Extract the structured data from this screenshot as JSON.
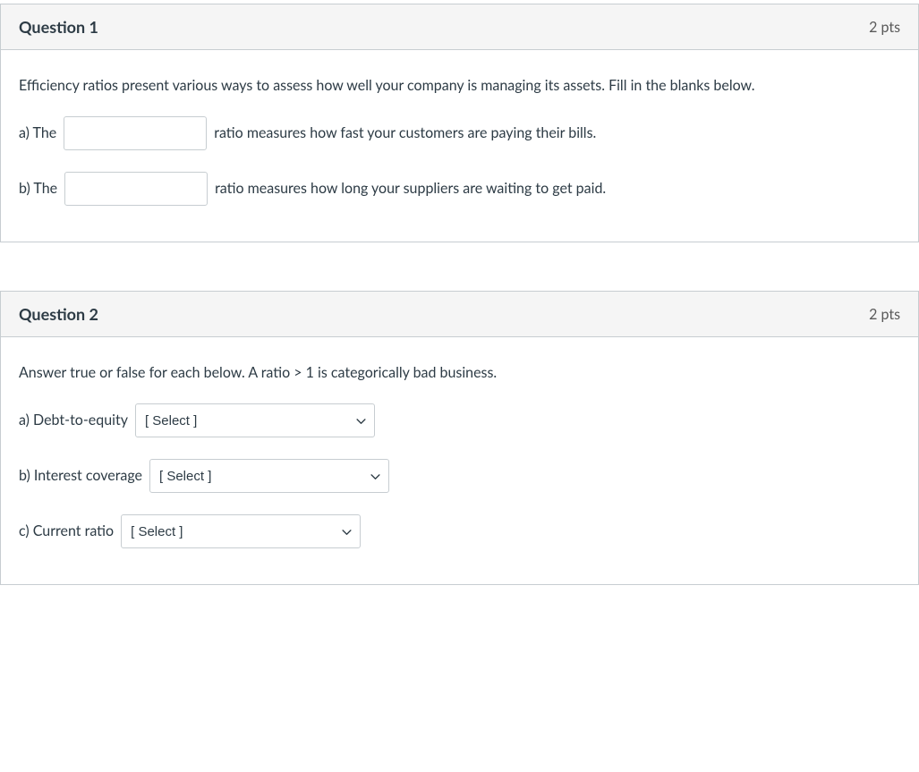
{
  "questions": [
    {
      "title": "Question 1",
      "points": "2 pts",
      "prompt": "Efficiency ratios present various ways to assess how well your company is managing its assets.  Fill in the blanks below.",
      "parts": [
        {
          "before": "a) The",
          "input_value": "",
          "after": "ratio measures how fast your customers are paying their bills."
        },
        {
          "before": "b) The",
          "input_value": "",
          "after": "ratio measures how long your suppliers are waiting to get paid."
        }
      ]
    },
    {
      "title": "Question 2",
      "points": "2 pts",
      "prompt": "Answer true or false for each below. A ratio > 1 is categorically bad business.",
      "parts": [
        {
          "label": "a) Debt-to-equity",
          "select_placeholder": "[ Select ]"
        },
        {
          "label": "b) Interest coverage",
          "select_placeholder": "[ Select ]"
        },
        {
          "label": "c) Current ratio",
          "select_placeholder": "[ Select ]"
        }
      ]
    }
  ]
}
